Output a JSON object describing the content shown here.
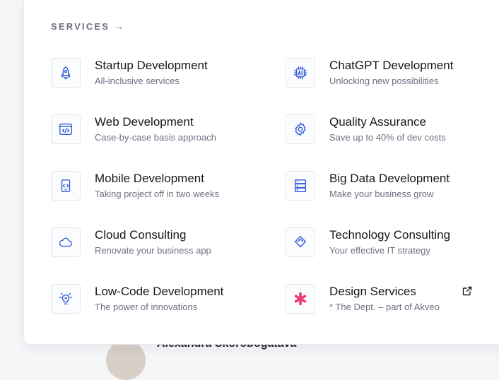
{
  "behind": {
    "name": "Alexandra Skorobogatava"
  },
  "services": {
    "heading": "SERVICES",
    "arrow": "→",
    "left": [
      {
        "title": "Startup Development",
        "subtitle": "All-inclusive services",
        "icon": "rocket-icon"
      },
      {
        "title": "Web Development",
        "subtitle": "Case-by-case basis approach",
        "icon": "browser-code-icon"
      },
      {
        "title": "Mobile Development",
        "subtitle": "Taking project off in two weeks",
        "icon": "phone-code-icon"
      },
      {
        "title": "Cloud Consulting",
        "subtitle": "Renovate your business app",
        "icon": "cloud-icon"
      },
      {
        "title": "Low-Code Development",
        "subtitle": "The power of innovations",
        "icon": "bulb-gear-icon"
      }
    ],
    "right": [
      {
        "title": "ChatGPT Development",
        "subtitle": "Unlocking new possibilities",
        "icon": "ai-chip-icon"
      },
      {
        "title": "Quality Assurance",
        "subtitle": "Save up to 40% of dev costs",
        "icon": "gear-icon"
      },
      {
        "title": "Big Data Development",
        "subtitle": "Make your business grow",
        "icon": "database-icon"
      },
      {
        "title": "Technology Consulting",
        "subtitle": "Your effective IT strategy",
        "icon": "layers-icon"
      },
      {
        "title": "Design Services",
        "subtitle": "* The Dept. – part of Akveo",
        "icon": "asterisk-icon"
      }
    ]
  },
  "colors": {
    "accent": "#2f5bd8",
    "design_accent": "#ee3a76",
    "text": "#17171f",
    "muted": "#6d7180"
  }
}
